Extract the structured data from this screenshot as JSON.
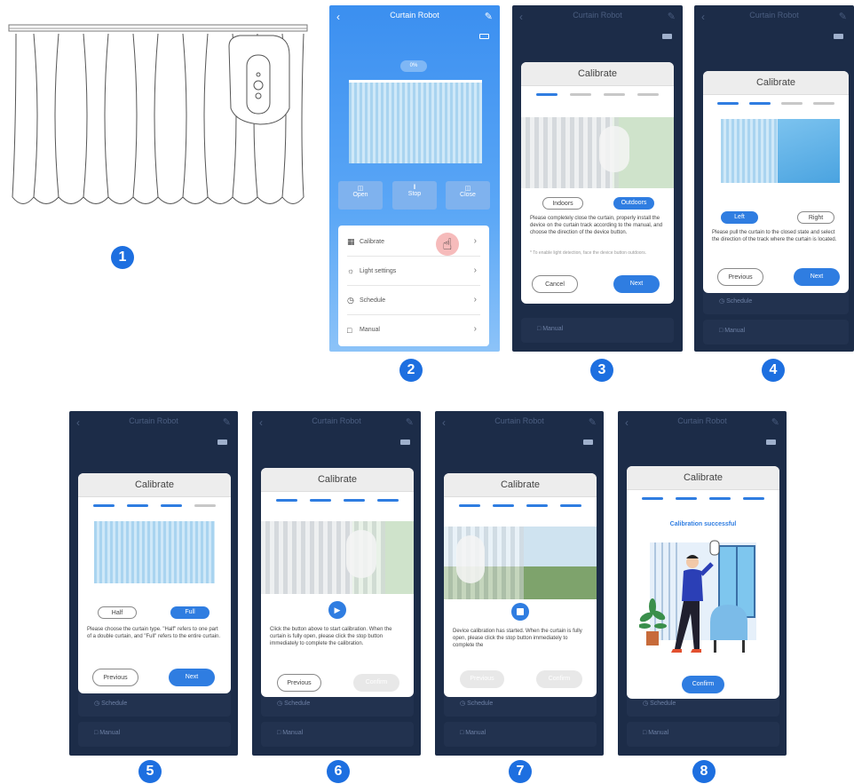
{
  "app": {
    "title": "Curtain Robot",
    "percent": "0%"
  },
  "controls": {
    "open": "Open",
    "stop": "Stop",
    "close": "Close"
  },
  "menu": {
    "calibrate": "Calibrate",
    "light": "Light settings",
    "schedule": "Schedule",
    "manual": "Manual"
  },
  "modal": {
    "title": "Calibrate"
  },
  "s3": {
    "indoors": "Indoors",
    "outdoors": "Outdoors",
    "text": "Please completely close the curtain, properly install the device on the curtain track according to the manual, and choose the direction of the device button.",
    "note": "* To enable light detection, face the device button outdoors.",
    "cancel": "Cancel",
    "next": "Next"
  },
  "s4": {
    "left": "Left",
    "right": "Right",
    "text": "Please pull the curtain to the closed state and select the direction of the track where the curtain is located.",
    "prev": "Previous",
    "next": "Next"
  },
  "s5": {
    "half": "Half",
    "full": "Full",
    "text": "Please choose the curtain type. \"Half\" refers to one part of a double curtain, and \"Full\" refers to the entire curtain.",
    "prev": "Previous",
    "next": "Next"
  },
  "s6": {
    "text": "Click the button above to start calibration. When the curtain is fully open, please click the stop button immediately to complete the calibration.",
    "prev": "Previous",
    "confirm": "Confirm"
  },
  "s7": {
    "text": "Device calibration has started. When the curtain is fully open, please click the stop button immediately to complete the",
    "prev": "Previous",
    "confirm": "Confirm"
  },
  "s8": {
    "success": "Calibration successful",
    "confirm": "Confirm"
  },
  "badges": [
    "1",
    "2",
    "3",
    "4",
    "5",
    "6",
    "7",
    "8"
  ],
  "colors": {
    "accent": "#2f7de1",
    "badge": "#1d6fe0",
    "dark_bg": "#1c2c48"
  }
}
